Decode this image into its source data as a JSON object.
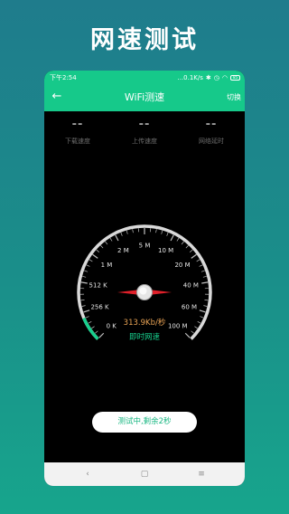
{
  "promo": {
    "title": "网速测试"
  },
  "status_bar": {
    "time": "下午2:54",
    "network_speed": "...0.1K/s",
    "battery": "85"
  },
  "app_bar": {
    "back_icon": "back-arrow-icon",
    "title": "WiFi测速",
    "switch_label": "切换"
  },
  "stats": [
    {
      "value": "--",
      "label": "下载速度"
    },
    {
      "value": "--",
      "label": "上传速度"
    },
    {
      "value": "--",
      "label": "网络延时"
    }
  ],
  "gauge": {
    "scale_labels": [
      "0 K",
      "256 K",
      "512 K",
      "1 M",
      "2 M",
      "5 M",
      "10 M",
      "20 M",
      "40 M",
      "60 M",
      "100 M"
    ],
    "current_speed": "313.9Kb/秒",
    "current_label": "即时网速",
    "needle_fraction": 0.5,
    "accent_color": "#18d08e",
    "needle_color": "#e0202a"
  },
  "test_status": "测试中,剩余2秒",
  "nav": {
    "back": "‹",
    "home": "▢",
    "menu": "≡"
  },
  "colors": {
    "primary": "#16c98a",
    "background_top": "#1f7c8c",
    "background_bottom": "#17a58c"
  }
}
